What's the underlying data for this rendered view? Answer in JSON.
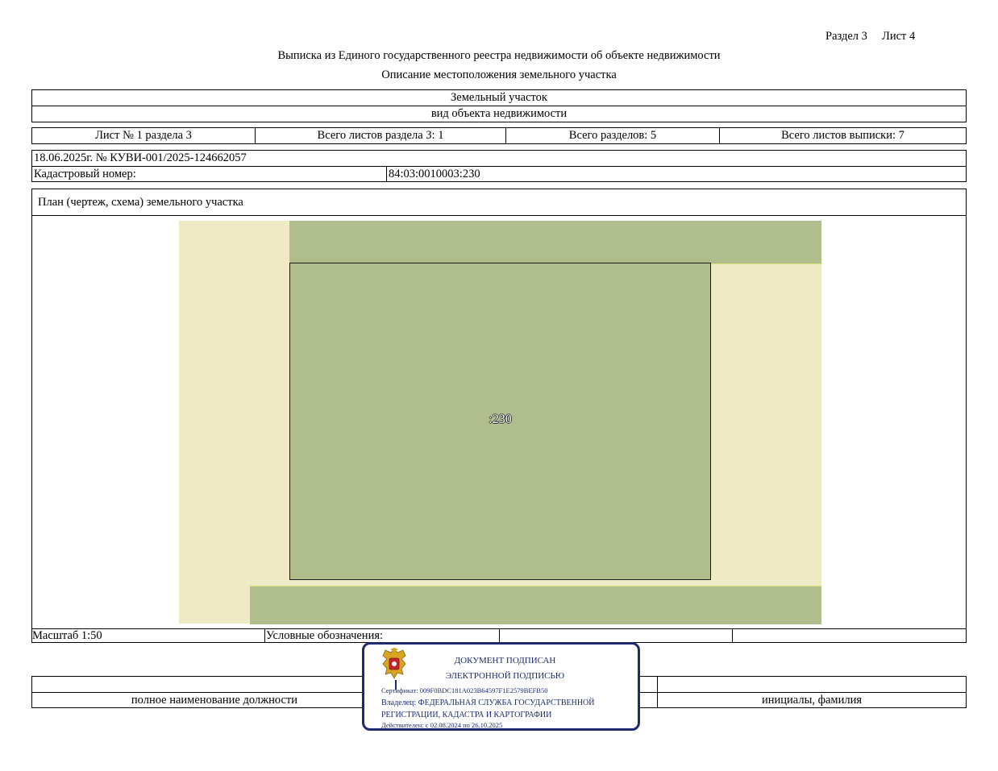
{
  "header": {
    "section": "Раздел 3",
    "sheet": "Лист 4",
    "title": "Выписка из Единого государственного реестра недвижимости об объекте недвижимости",
    "subtitle": "Описание местоположения земельного участка"
  },
  "object": {
    "type": "Земельный участок",
    "type_caption": "вид объекта недвижимости"
  },
  "sheets_row": {
    "sheet_no": "Лист № 1 раздела 3",
    "total_sheets_section": "Всего листов раздела 3: 1",
    "total_sections": "Всего разделов: 5",
    "total_sheets_extract": "Всего листов выписки: 7"
  },
  "record": {
    "date_number": "18.06.2025г. № КУВИ-001/2025-124662057",
    "cadastral_label": "Кадастровый номер:",
    "cadastral_value": "84:03:0010003:230"
  },
  "plan": {
    "title": "План (чертеж, схема) земельного участка",
    "parcel_label": ":230",
    "colors": {
      "background": "#efeac6",
      "neighbor_parcel": "#b0bd8d",
      "main_parcel": "#b0bd8d",
      "border": "#1a1a1a"
    }
  },
  "footer": {
    "scale": "Масштаб 1:50",
    "legend_label": "Условные обозначения:",
    "position_caption": "полное наименование должности",
    "name_caption": "инициалы, фамилия"
  },
  "signature": {
    "line1": "ДОКУМЕНТ ПОДПИСАН",
    "line2": "ЭЛЕКТРОННОЙ ПОДПИСЬЮ",
    "certificate": "Сертификат: 009F0BDC181A023B64597F1E2579BEFB50",
    "owner_line1": "Владелец: ФЕДЕРАЛЬНАЯ СЛУЖБА ГОСУДАРСТВЕННОЙ",
    "owner_line2": "РЕГИСТРАЦИИ, КАДАСТРА И КАРТОГРАФИИ",
    "validity": "Действителен: с 02.08.2024 по 26.10.2025",
    "color": "#1e2a6e",
    "emblem": "coat-of-arms-emblem"
  }
}
